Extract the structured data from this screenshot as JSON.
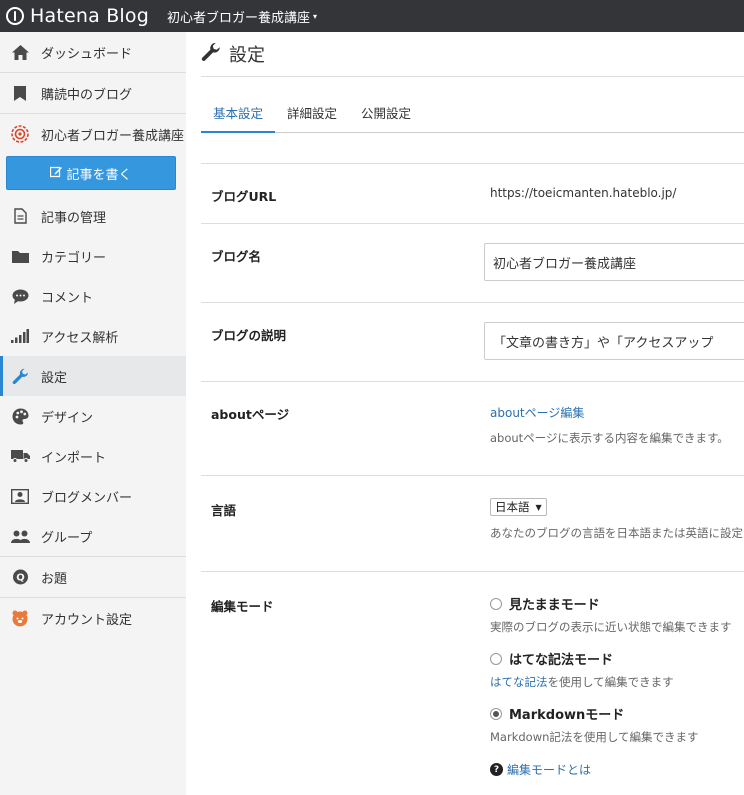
{
  "topbar": {
    "logo_text": "Hatena Blog",
    "blog_name": "初心者ブロガー養成講座",
    "caret": "▾"
  },
  "sidebar": {
    "items_top": [
      {
        "label": "ダッシュボード",
        "icon": "home-icon"
      },
      {
        "label": "購読中のブログ",
        "icon": "bookmark-icon"
      },
      {
        "label": "初心者ブロガー養成講座",
        "icon": "blog-icon"
      }
    ],
    "write_button": "記事を書く",
    "items_main": [
      {
        "label": "記事の管理",
        "icon": "document-icon"
      },
      {
        "label": "カテゴリー",
        "icon": "folder-icon"
      },
      {
        "label": "コメント",
        "icon": "comment-icon"
      },
      {
        "label": "アクセス解析",
        "icon": "signal-icon"
      },
      {
        "label": "設定",
        "icon": "wrench-icon",
        "active": true
      },
      {
        "label": "デザイン",
        "icon": "palette-icon"
      },
      {
        "label": "インポート",
        "icon": "truck-icon"
      },
      {
        "label": "ブログメンバー",
        "icon": "member-icon"
      }
    ],
    "items_lower": [
      {
        "label": "グループ",
        "icon": "group-icon"
      },
      {
        "label": "お題",
        "icon": "topic-icon"
      },
      {
        "label": "アカウント設定",
        "icon": "account-icon"
      }
    ]
  },
  "main": {
    "title": "設定",
    "tabs": [
      {
        "label": "基本設定",
        "active": true
      },
      {
        "label": "詳細設定"
      },
      {
        "label": "公開設定"
      }
    ],
    "settings": {
      "url": {
        "label": "ブログURL",
        "value": "https://toeicmanten.hateblo.jp/"
      },
      "name": {
        "label": "ブログ名",
        "value": "初心者ブロガー養成講座"
      },
      "description": {
        "label": "ブログの説明",
        "value": "「文章の書き方」や「アクセスアップ"
      },
      "about": {
        "label": "aboutページ",
        "link": "aboutページ編集",
        "help": "aboutページに表示する内容を編集できます。"
      },
      "language": {
        "label": "言語",
        "selected": "日本語",
        "help": "あなたのブログの言語を日本語または英語に設定"
      },
      "edit_mode": {
        "label": "編集モード",
        "options": [
          {
            "label": "見たままモード",
            "help": "実際のブログの表示に近い状態で編集できます",
            "checked": false
          },
          {
            "label": "はてな記法モード",
            "help_link": "はてな記法",
            "help": "を使用して編集できます",
            "checked": false
          },
          {
            "label": "Markdownモード",
            "help": "Markdown記法を使用して編集できます",
            "checked": true
          }
        ],
        "help_link": "編集モードとは"
      }
    }
  }
}
